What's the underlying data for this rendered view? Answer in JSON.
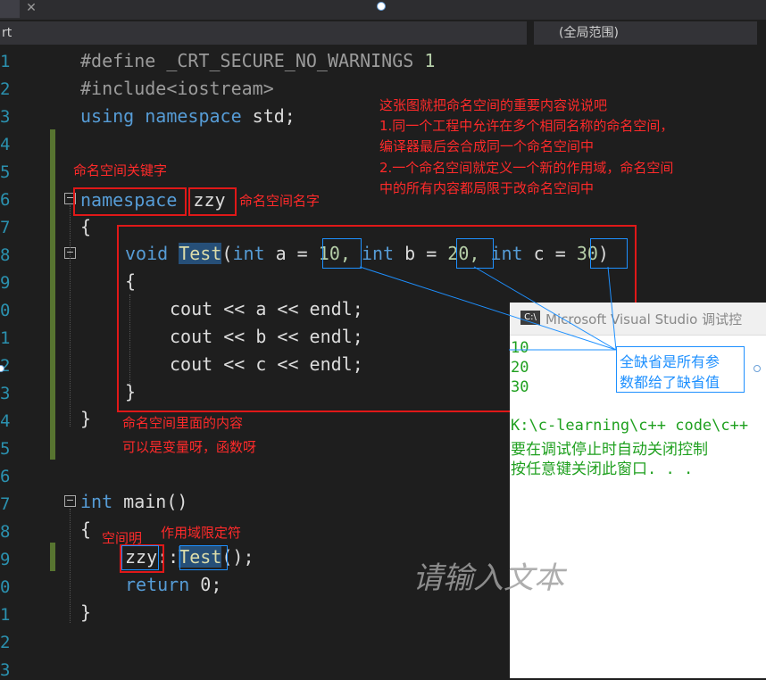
{
  "nav": {
    "left_text": "rt",
    "scope_dropdown": "(全局范围)"
  },
  "line_numbers": [
    "1",
    "2",
    "3",
    "4",
    "5",
    "6",
    "7",
    "8",
    "9",
    "0",
    "1",
    "2",
    "3",
    "4",
    "5",
    "6",
    "7",
    "8",
    "9",
    "0",
    "1",
    "2",
    "3"
  ],
  "code": {
    "l1_a": "#define ",
    "l1_b": "_CRT_SECURE_NO_WARNINGS",
    "l1_c": " 1",
    "l2": "#include<iostream>",
    "l3_kw": "using namespace",
    "l3_rest": " std;",
    "ns_kw": "namespace",
    "ns_name": "zzy",
    "brace_open": "{",
    "brace_close": "}",
    "void_kw": "void",
    "test_fn": "Test",
    "paren_open": "(",
    "int_kw": "int",
    "param_a": " a = ",
    "val_a": "10,",
    "param_b": " b = ",
    "val_b": "20,",
    "param_c": " c = ",
    "val_c": "30",
    "paren_close": ")",
    "cout_a": "cout << a << endl;",
    "cout_b": "cout << b << endl;",
    "cout_c": "cout << c << endl;",
    "main_kw": "int",
    "main_rest": " main()",
    "call_ns": "zzy",
    "call_sep": "::",
    "call_fn": "Test",
    "call_end": "();",
    "ret_kw": "return",
    "ret_rest": " 0;"
  },
  "annotations": {
    "intro": "这张图就把命名空间的重要内容说说吧",
    "point1a": "1.同一个工程中允许在多个相同名称的命名空间，",
    "point1b": "编译器最后会合成同一个命名空间中",
    "point2a": "2.一个命名空间就定义一个新的作用域，命名空间",
    "point2b": "中的所有内容都局限于改命名空间中",
    "ns_keyword": "命名空间关键字",
    "ns_name": "命名空间名字",
    "ns_content_a": "命名空间里面的内容",
    "ns_content_b": "可以是变量呀，函数呀",
    "empty_ns": "空间明",
    "scope_op": "作用域限定符",
    "defaults_a": "全缺省是所有参",
    "defaults_b": "数都给了缺省值"
  },
  "console": {
    "title": "Microsoft Visual Studio 调试控",
    "icon": "C:\\",
    "out1": "10",
    "out2": "20",
    "out3": "30",
    "path": "K:\\c-learning\\c++ code\\c++",
    "msg1": "要在调试停止时自动关闭控制",
    "msg2": "按任意键关闭此窗口. . ."
  },
  "watermark": "请输入文本"
}
